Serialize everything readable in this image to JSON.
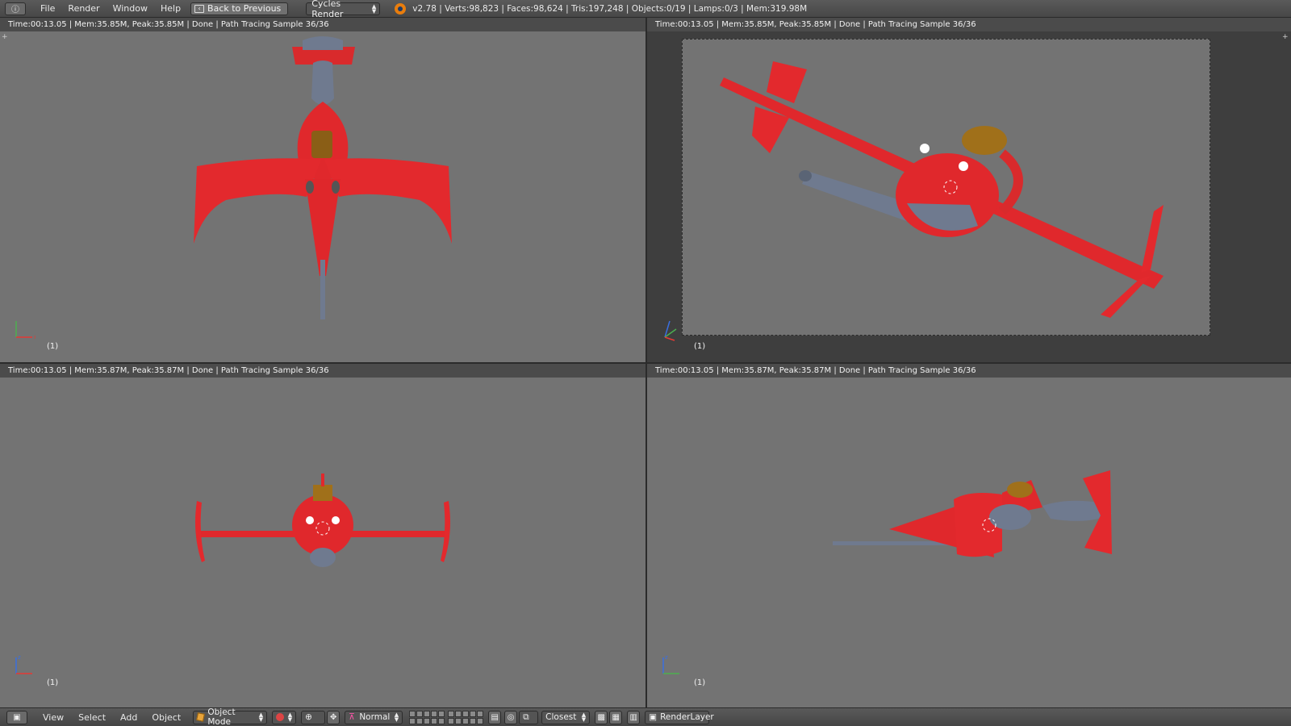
{
  "topbar": {
    "menus": [
      "File",
      "Render",
      "Window",
      "Help"
    ],
    "back_button": "Back to Previous",
    "render_engine": "Cycles Render",
    "stats": "v2.78 | Verts:98,823 | Faces:98,624 | Tris:197,248 | Objects:0/19 | Lamps:0/3 | Mem:319.98M"
  },
  "viewports": [
    {
      "info": "Time:00:13.05 | Mem:35.85M, Peak:35.85M | Done | Path Tracing Sample 36/36",
      "frame": "(1)"
    },
    {
      "info": "Time:00:13.05 | Mem:35.85M, Peak:35.85M | Done | Path Tracing Sample 36/36",
      "frame": "(1)"
    },
    {
      "info": "Time:00:13.05 | Mem:35.87M, Peak:35.87M | Done | Path Tracing Sample 36/36",
      "frame": "(1)"
    },
    {
      "info": "Time:00:13.05 | Mem:35.87M, Peak:35.87M | Done | Path Tracing Sample 36/36",
      "frame": "(1)"
    }
  ],
  "bottombar": {
    "menus": [
      "View",
      "Select",
      "Add",
      "Object"
    ],
    "mode": "Object Mode",
    "pivot": "Normal",
    "snap": "Closest",
    "render_layer": "RenderLayer"
  },
  "colors": {
    "ship_red": "#e0282c",
    "ship_grey": "#6f7a8f",
    "viewport_bg": "#737373",
    "canopy": "#a0701a"
  }
}
